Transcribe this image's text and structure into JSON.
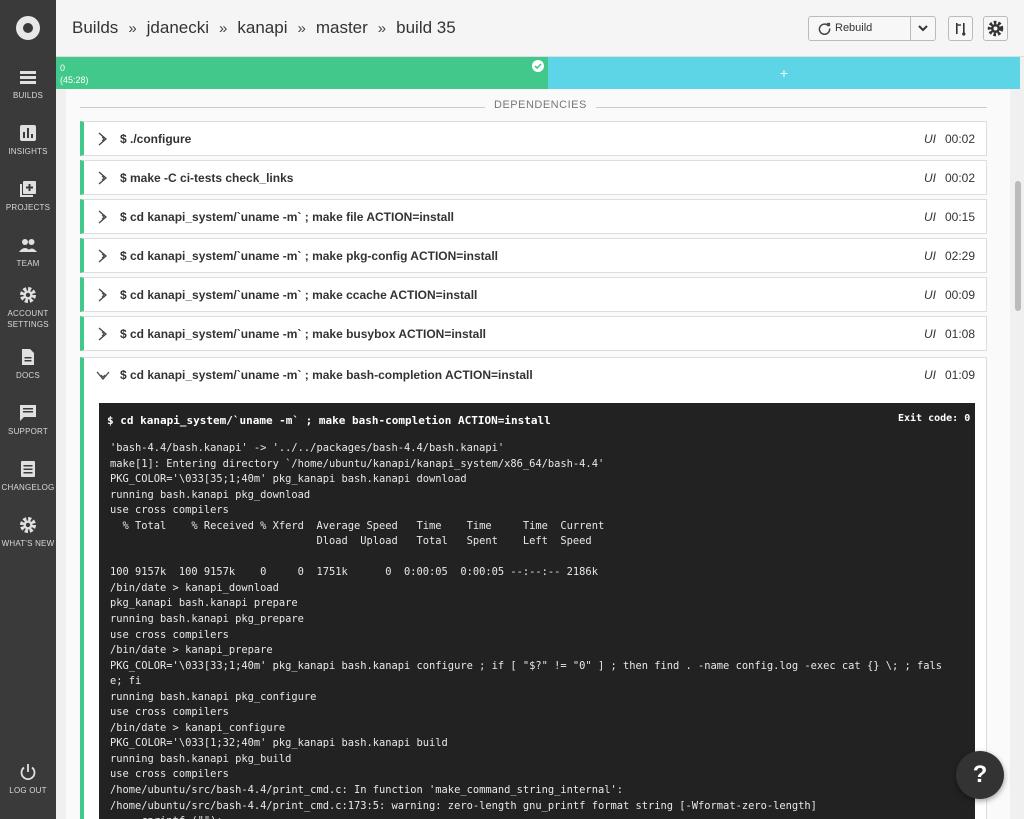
{
  "sidebar": {
    "items": [
      {
        "label": "BUILDS",
        "icon": "builds-icon"
      },
      {
        "label": "INSIGHTS",
        "icon": "insights-icon"
      },
      {
        "label": "PROJECTS",
        "icon": "projects-icon"
      },
      {
        "label": "TEAM",
        "icon": "team-icon"
      },
      {
        "label": "ACCOUNT",
        "label2": "SETTINGS",
        "icon": "gear-icon"
      },
      {
        "label": "DOCS",
        "icon": "docs-icon"
      },
      {
        "label": "SUPPORT",
        "icon": "support-icon"
      },
      {
        "label": "CHANGELOG",
        "icon": "changelog-icon"
      },
      {
        "label": "WHAT'S NEW",
        "icon": "whats-new-icon"
      }
    ],
    "logout": "LOG OUT"
  },
  "breadcrumb": [
    "Builds",
    "jdanecki",
    "kanapi",
    "master",
    "build 35"
  ],
  "breadcrumb_sep": "»",
  "toolbar": {
    "rebuild_label": "Rebuild"
  },
  "strip": {
    "container": "0",
    "duration": "(45:28)",
    "add": "+"
  },
  "section_title": "DEPENDENCIES",
  "steps": [
    {
      "cmd": "$ ./configure",
      "ui": "UI",
      "time": "00:02"
    },
    {
      "cmd": "$ make -C ci-tests check_links",
      "ui": "UI",
      "time": "00:02"
    },
    {
      "cmd": "$ cd kanapi_system/`uname -m` ; make file ACTION=install",
      "ui": "UI",
      "time": "00:15"
    },
    {
      "cmd": "$ cd kanapi_system/`uname -m` ; make pkg-config ACTION=install",
      "ui": "UI",
      "time": "02:29"
    },
    {
      "cmd": "$ cd kanapi_system/`uname -m` ; make ccache ACTION=install",
      "ui": "UI",
      "time": "00:09"
    },
    {
      "cmd": "$ cd kanapi_system/`uname -m` ; make busybox ACTION=install",
      "ui": "UI",
      "time": "01:08"
    },
    {
      "cmd": "$ cd kanapi_system/`uname -m` ; make bash-completion ACTION=install",
      "ui": "UI",
      "time": "01:09"
    }
  ],
  "terminal": {
    "header": "$ cd kanapi_system/`uname -m` ; make bash-completion ACTION=install",
    "exit": "Exit code: 0",
    "lines": [
      "'bash-4.4/bash.kanapi' -> '../../packages/bash-4.4/bash.kanapi'",
      "make[1]: Entering directory `/home/ubuntu/kanapi/kanapi_system/x86_64/bash-4.4'",
      "PKG_COLOR='\\033[35;1;40m' pkg_kanapi bash.kanapi download",
      "running bash.kanapi pkg_download",
      "use cross compilers",
      "  % Total    % Received % Xferd  Average Speed   Time    Time     Time  Current",
      "                                 Dload  Upload   Total   Spent    Left  Speed",
      "",
      "100 9157k  100 9157k    0     0  1751k      0  0:00:05  0:00:05 --:--:-- 2186k",
      "/bin/date > kanapi_download",
      "pkg_kanapi bash.kanapi prepare",
      "running bash.kanapi pkg_prepare",
      "use cross compilers",
      "/bin/date > kanapi_prepare",
      "PKG_COLOR='\\033[33;1;40m' pkg_kanapi bash.kanapi configure ; if [ \"$?\" != \"0\" ] ; then find . -name config.log -exec cat {} \\; ; fals",
      "e; fi",
      "running bash.kanapi pkg_configure",
      "use cross compilers",
      "/bin/date > kanapi_configure",
      "PKG_COLOR='\\033[1;32;40m' pkg_kanapi bash.kanapi build",
      "running bash.kanapi pkg_build",
      "use cross compilers",
      "/home/ubuntu/src/bash-4.4/print_cmd.c: In function 'make_command_string_internal':",
      "/home/ubuntu/src/bash-4.4/print_cmd.c:173:5: warning: zero-length gnu_printf format string [-Wformat-zero-length]",
      "     cprintf (\"\");"
    ]
  },
  "help_label": "?",
  "colors": {
    "success": "#42c88a",
    "running": "#5dd5e6",
    "sidebar": "#3a3a3a",
    "terminal": "#222222"
  }
}
